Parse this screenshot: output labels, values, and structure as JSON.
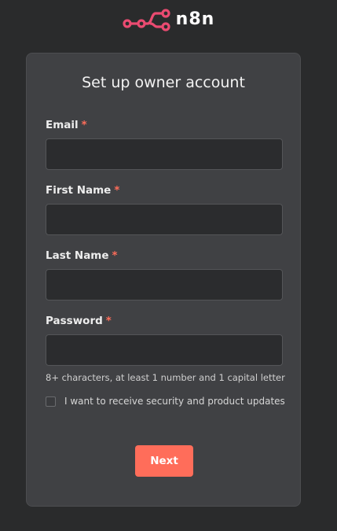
{
  "brand": {
    "name": "n8n",
    "accent_color": "#ea4b71",
    "icon": "n8n-logo-icon"
  },
  "form": {
    "title": "Set up owner account",
    "required_marker": "*",
    "fields": [
      {
        "label": "Email",
        "value": "",
        "required": true
      },
      {
        "label": "First Name",
        "value": "",
        "required": true
      },
      {
        "label": "Last Name",
        "value": "",
        "required": true
      },
      {
        "label": "Password",
        "value": "",
        "required": true
      }
    ],
    "password_hint": "8+ characters, at least 1 number and 1 capital letter",
    "updates_checkbox": {
      "label": "I want to receive security and product updates",
      "checked": false
    },
    "submit_label": "Next",
    "button_color": "#ff6d5a"
  }
}
